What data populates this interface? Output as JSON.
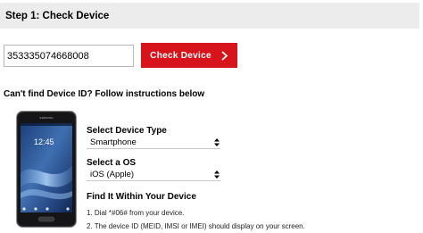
{
  "header": {
    "title": "Step 1: Check Device"
  },
  "device_id": {
    "value": "353335074668008"
  },
  "check_button": {
    "label": "Check Device",
    "icon": "chevron-right-icon"
  },
  "instructions_heading": "Can't find Device ID? Follow instructions below",
  "phone_image": {
    "brand": "SAMSUNG",
    "clock": "12:45"
  },
  "device_type": {
    "label": "Select Device Type",
    "selected": "Smartphone"
  },
  "os": {
    "label": "Select a OS",
    "selected": "iOS (Apple)"
  },
  "find": {
    "heading": "Find It Within Your Device",
    "steps": [
      "1. Dial *#06# from your device.",
      "2. The device ID (MEID, IMSI or IMEI) should display on your screen."
    ]
  },
  "colors": {
    "accent": "#d7141c",
    "header_bg": "#ececec"
  }
}
